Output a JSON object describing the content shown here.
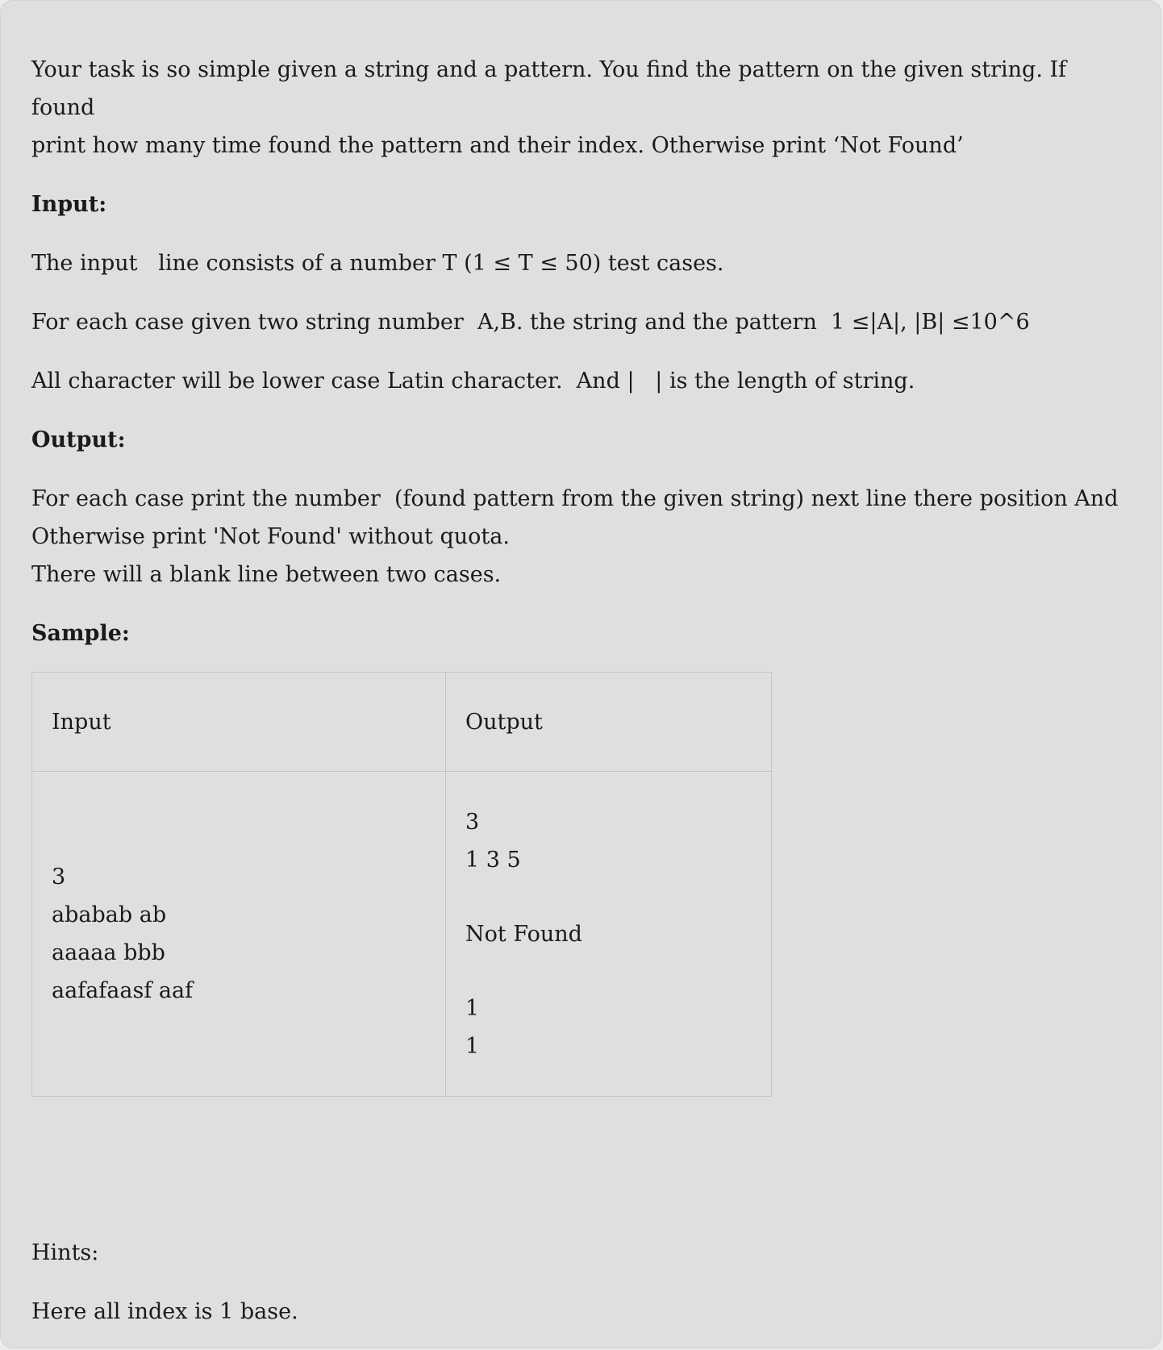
{
  "intro": {
    "line1": "Your task is so simple given a string and a pattern. You find the pattern on the given string. If found",
    "line2": "print how many time found the pattern and their index. Otherwise print ‘Not Found’"
  },
  "input_section": {
    "heading": "Input:",
    "line1": "The input   line consists of a number T (1 ≤ T ≤ 50) test cases.",
    "line2": "For each case given two string number  A,B. the string and the pattern  1 ≤|A|, |B| ≤10^6",
    "line3": "All character will be lower case Latin character.  And |   | is the length of string."
  },
  "output_section": {
    "heading": "Output:",
    "line1": "For each case print the number  (found pattern from the given string) next line there position And",
    "line2": "Otherwise print 'Not Found' without quota.",
    "line3": "There will a blank line between two cases."
  },
  "sample": {
    "heading": "Sample:",
    "col_input": "Input",
    "col_output": "Output",
    "input_lines": [
      "3",
      "ababab ab",
      "aaaaa bbb",
      "aafafaasf aaf"
    ],
    "output_lines": [
      "3",
      "1 3 5",
      "",
      "Not Found",
      "",
      "1",
      "1"
    ]
  },
  "hints": {
    "heading": "Hints:",
    "text": "Here all index is 1 base."
  }
}
